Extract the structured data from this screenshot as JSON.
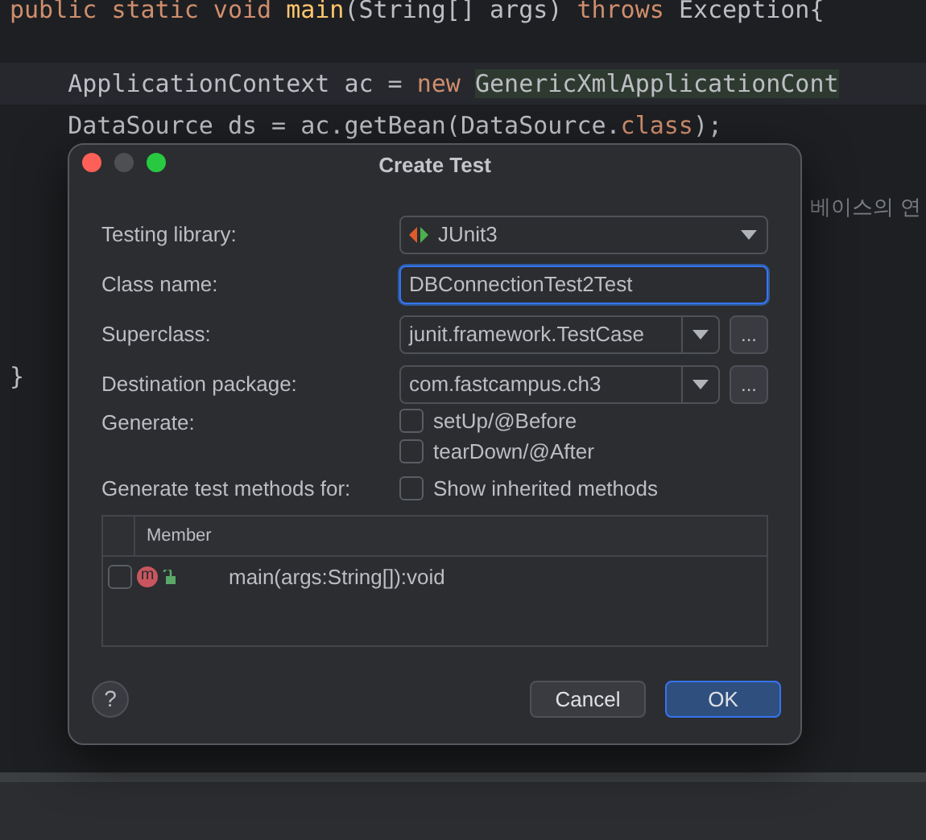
{
  "editor": {
    "lines": [
      {
        "current": false,
        "segments": [
          {
            "text": "public static void ",
            "kind": "keyword"
          },
          {
            "text": "main",
            "kind": "method"
          },
          {
            "text": "(String[] args) ",
            "kind": "plain"
          },
          {
            "text": "throws ",
            "kind": "keyword"
          },
          {
            "text": "Exception{",
            "kind": "plain"
          }
        ]
      },
      {
        "current": false
      },
      {
        "current": true,
        "segments": [
          {
            "text": "    ApplicationContext ac = ",
            "kind": "plain"
          },
          {
            "text": "new ",
            "kind": "keyword"
          },
          {
            "text": "GenericXmlApplicationCont",
            "kind": "match"
          }
        ]
      },
      {
        "current": false,
        "segments": [
          {
            "text": "    DataSource ds = ac.getBean(DataSource.",
            "kind": "plain"
          },
          {
            "text": "class",
            "kind": "keyword"
          },
          {
            "text": ");",
            "kind": "plain"
          }
        ]
      },
      {
        "current": false
      },
      {
        "current": false,
        "segments": [
          {
            "text": "베이스의 연",
            "kind": "comment"
          }
        ]
      },
      {
        "current": false
      },
      {
        "current": false
      },
      {
        "current": false
      },
      {
        "current": false,
        "segments": [
          {
            "text": "}",
            "kind": "plain"
          }
        ]
      }
    ]
  },
  "dialog": {
    "title": "Create Test",
    "fields": [
      {
        "kind": "select",
        "label": "Testing library:",
        "value": "JUnit3"
      },
      {
        "kind": "input",
        "label": "Class name:",
        "value": "DBConnectionTest2Test"
      },
      {
        "kind": "combo",
        "label": "Superclass:",
        "value": "junit.framework.TestCase",
        "button": "..."
      },
      {
        "kind": "combo",
        "label": "Destination package:",
        "value": "com.fastcampus.ch3",
        "button": "..."
      }
    ],
    "generate": {
      "label": "Generate:",
      "options": [
        {
          "label": "setUp/@Before",
          "checked": false
        },
        {
          "label": "tearDown/@After",
          "checked": false
        }
      ]
    },
    "methods": {
      "label": "Generate test methods for:",
      "inherited": {
        "label": "Show inherited methods",
        "checked": false
      },
      "column": "Member",
      "rows": [
        {
          "icon": "m",
          "name": "main(args:String[]):void",
          "checked": false
        }
      ]
    },
    "help": "?",
    "buttons": [
      {
        "label": "Cancel",
        "kind": "secondary"
      },
      {
        "label": "OK",
        "kind": "primary"
      }
    ]
  }
}
